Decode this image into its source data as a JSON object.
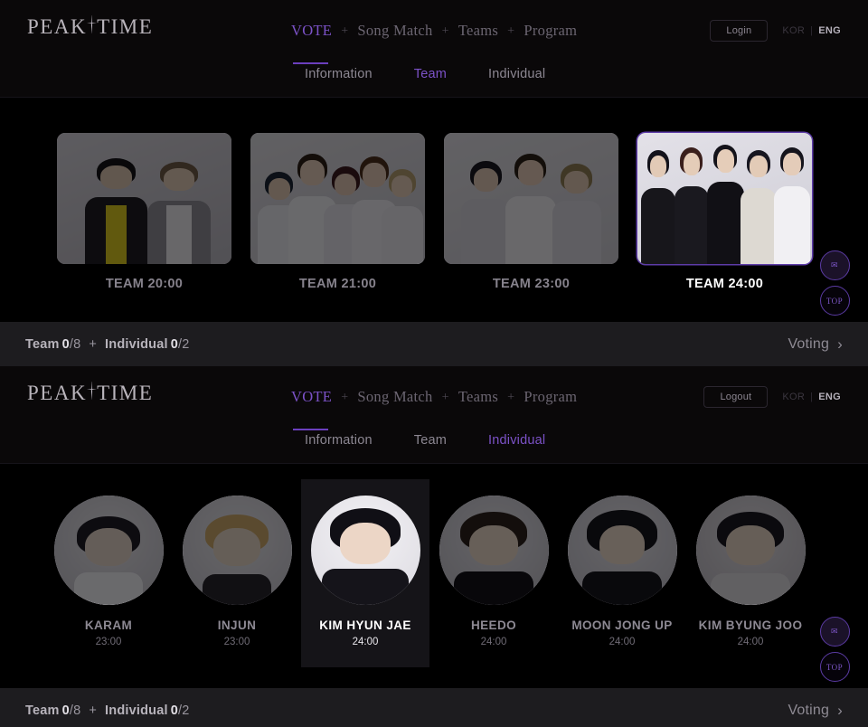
{
  "brand": {
    "name_part1": "PEAK",
    "name_part2": "TIME"
  },
  "sections": [
    {
      "header": {
        "nav": [
          {
            "label": "VOTE",
            "active": true
          },
          {
            "label": "Song Match",
            "active": false
          },
          {
            "label": "Teams",
            "active": false
          },
          {
            "label": "Program",
            "active": false
          }
        ],
        "separator": "+",
        "auth_label": "Login",
        "lang": {
          "kor": "KOR",
          "sep": "|",
          "eng": "ENG"
        },
        "subtabs": [
          {
            "label": "Information",
            "active": false
          },
          {
            "label": "Team",
            "active": true
          },
          {
            "label": "Individual",
            "active": false
          }
        ]
      },
      "teams": [
        {
          "label": "TEAM 20:00",
          "selected": false
        },
        {
          "label": "TEAM 21:00",
          "selected": false
        },
        {
          "label": "TEAM 23:00",
          "selected": false
        },
        {
          "label": "TEAM 24:00",
          "selected": true
        }
      ],
      "footer": {
        "team_word": "Team",
        "team_count": "0",
        "team_max": "/8",
        "plus": "+",
        "indiv_word": "Individual",
        "indiv_count": "0",
        "indiv_max": "/2",
        "voting_label": "Voting",
        "voting_chevron": "›"
      },
      "floaters": [
        {
          "name": "chat-icon",
          "glyph": "✉"
        },
        {
          "name": "top-label",
          "glyph": "TOP"
        }
      ]
    },
    {
      "header": {
        "nav": [
          {
            "label": "VOTE",
            "active": true
          },
          {
            "label": "Song Match",
            "active": false
          },
          {
            "label": "Teams",
            "active": false
          },
          {
            "label": "Program",
            "active": false
          }
        ],
        "separator": "+",
        "auth_label": "Logout",
        "lang": {
          "kor": "KOR",
          "sep": "|",
          "eng": "ENG"
        },
        "subtabs": [
          {
            "label": "Information",
            "active": false
          },
          {
            "label": "Team",
            "active": false
          },
          {
            "label": "Individual",
            "active": true
          }
        ]
      },
      "people": [
        {
          "name": "KARAM",
          "time": "23:00",
          "selected": false
        },
        {
          "name": "INJUN",
          "time": "23:00",
          "selected": false
        },
        {
          "name": "KIM HYUN JAE",
          "time": "24:00",
          "selected": true
        },
        {
          "name": "HEEDO",
          "time": "24:00",
          "selected": false
        },
        {
          "name": "MOON JONG UP",
          "time": "24:00",
          "selected": false
        },
        {
          "name": "KIM BYUNG JOO",
          "time": "24:00",
          "selected": false
        }
      ],
      "footer": {
        "team_word": "Team",
        "team_count": "0",
        "team_max": "/8",
        "plus": "+",
        "indiv_word": "Individual",
        "indiv_count": "0",
        "indiv_max": "/2",
        "voting_label": "Voting",
        "voting_chevron": "›"
      },
      "floaters": [
        {
          "name": "chat-icon",
          "glyph": "✉"
        },
        {
          "name": "top-label",
          "glyph": "TOP"
        }
      ]
    }
  ],
  "colors": {
    "accent_purple": "#7c52c8",
    "accent_border": "#5b3ba4",
    "background": "#000000",
    "header_bg": "#0a0809",
    "footer_bg": "#1d1c1f",
    "text_muted": "#8c8891",
    "text_active": "#ffffff"
  }
}
